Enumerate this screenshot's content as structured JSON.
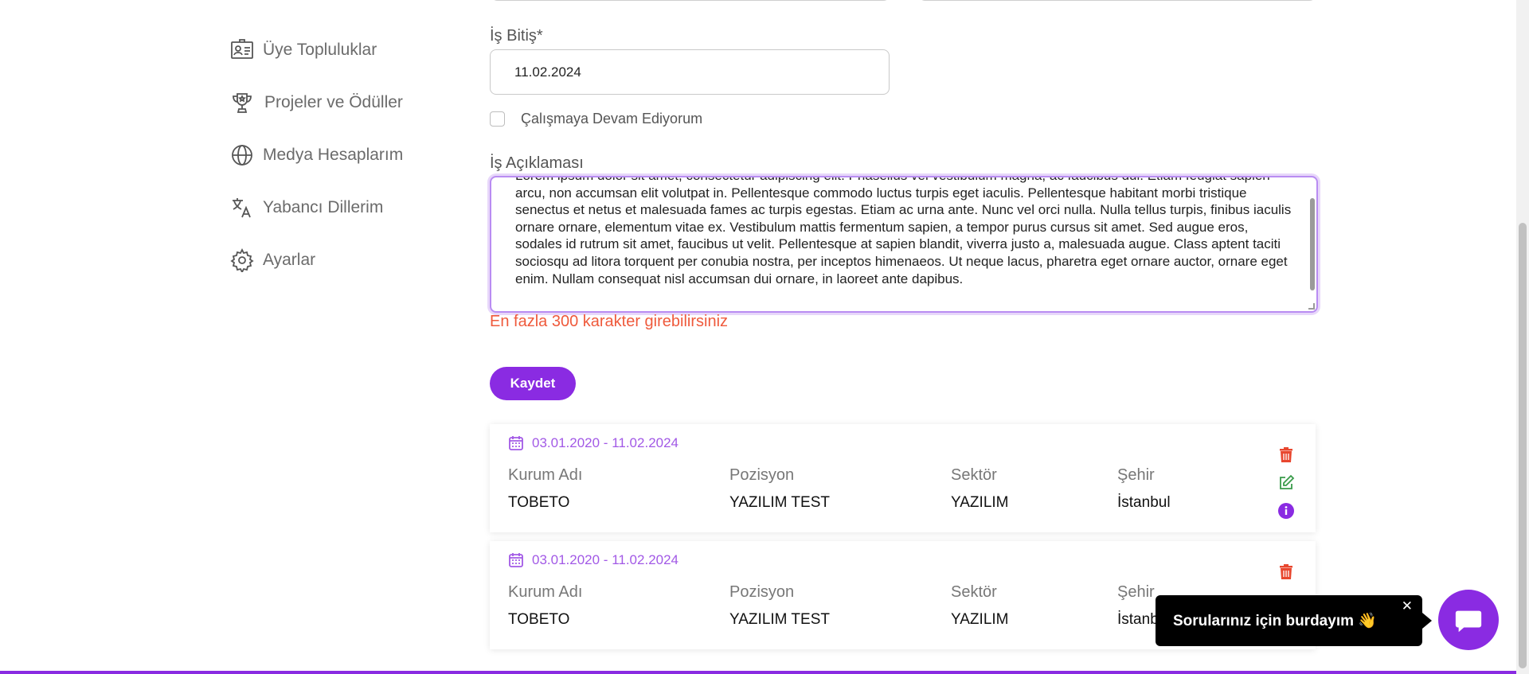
{
  "sidebar": {
    "items": [
      {
        "label": "Üye Topluluklar",
        "icon": "id-card-icon"
      },
      {
        "label": "Projeler ve Ödüller",
        "icon": "trophy-icon"
      },
      {
        "label": "Medya Hesaplarım",
        "icon": "globe-icon"
      },
      {
        "label": "Yabancı Dillerim",
        "icon": "translate-icon"
      },
      {
        "label": "Ayarlar",
        "icon": "gear-icon"
      }
    ]
  },
  "form": {
    "end_label": "İş Bitiş*",
    "end_value": "11.02.2024",
    "still_working_label": "Çalışmaya Devam Ediyorum",
    "description_label": "İş Açıklaması",
    "description_value": "Lorem ipsum dolor sit amet, consectetur adipiscing elit. Phasellus vel vestibulum magna, ac faucibus dui. Etiam feugiat sapien arcu, non accumsan elit volutpat in. Pellentesque commodo luctus turpis eget iaculis. Pellentesque habitant morbi tristique senectus et netus et malesuada fames ac turpis egestas. Etiam ac urna ante. Nunc vel orci nulla. Nulla tellus turpis, finibus iaculis ornare ornare, elementum vitae ex. Vestibulum mattis fermentum sapien, a tempor purus cursus sit amet. Sed augue eros, sodales id rutrum sit amet, faucibus ut velit. Pellentesque at sapien blandit, viverra justo a, malesuada augue. Class aptent taciti sociosqu ad litora torquent per conubia nostra, per inceptos himenaeos. Ut neque lacus, pharetra eget ornare auctor, ornare eget enim. Nullam consequat nisl accumsan dui ornare, in laoreet ante dapibus.",
    "error": "En fazla 300 karakter girebilirsiniz",
    "save_label": "Kaydet"
  },
  "headers": {
    "company": "Kurum Adı",
    "position": "Pozisyon",
    "sector": "Sektör",
    "city": "Şehir"
  },
  "experiences": [
    {
      "dates": "03.01.2020 - 11.02.2024",
      "company": "TOBETO",
      "position": "YAZILIM TEST",
      "sector": "YAZILIM",
      "city": "İstanbul"
    },
    {
      "dates": "03.01.2020 - 11.02.2024",
      "company": "TOBETO",
      "position": "YAZILIM TEST",
      "sector": "YAZILIM",
      "city": "İstanbul"
    }
  ],
  "chat": {
    "message": "Sorularınız için burdayım 👋",
    "close": "✕"
  },
  "colors": {
    "accent": "#8a2be2",
    "date_text": "#a259e6",
    "error": "#ef5a3c",
    "delete": "#e8472f",
    "edit": "#3a9b4a"
  }
}
